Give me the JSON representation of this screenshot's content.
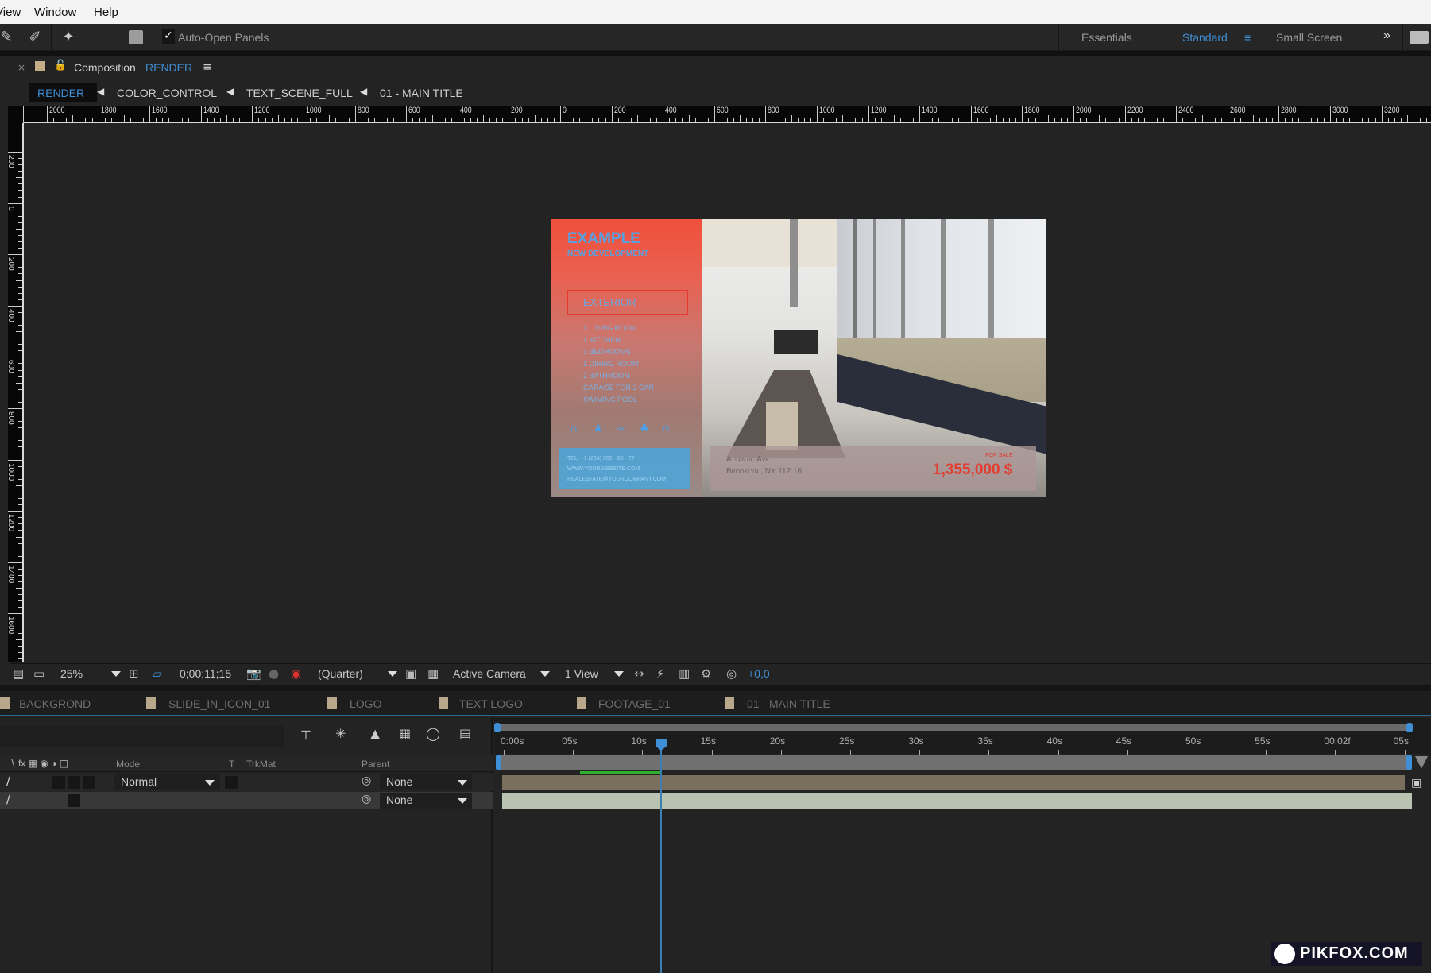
{
  "menu": {
    "items": [
      "View",
      "Window",
      "Help"
    ]
  },
  "toolbar": {
    "auto_open_panels_label": "Auto-Open Panels",
    "auto_open_checked": true,
    "workspaces": [
      "Essentials",
      "Standard",
      "Small Screen"
    ],
    "active_workspace": "Standard",
    "overflow_glyph": "»"
  },
  "composition": {
    "panel_prefix": "Composition",
    "name": "RENDER",
    "breadcrumbs": [
      "RENDER",
      "COLOR_CONTROL",
      "TEXT_SCENE_FULL",
      "01 - MAIN TITLE"
    ],
    "ruler_h_labels": [
      "2000",
      "1800",
      "1600",
      "1400",
      "1200",
      "1000",
      "800",
      "600",
      "400",
      "200",
      "0",
      "200",
      "400",
      "600",
      "800",
      "1000",
      "1200",
      "1400",
      "1600",
      "1800",
      "2000",
      "2200",
      "2400",
      "2600",
      "2800",
      "3000",
      "3200"
    ],
    "ruler_v_labels": [
      "200",
      "0",
      "200",
      "400",
      "600",
      "800",
      "1000",
      "1200",
      "1400",
      "1600"
    ]
  },
  "preview": {
    "title": "EXAMPLE",
    "subtitle": "NEW DEVELOPMENT",
    "section": "EXTERIOR",
    "features": [
      "1 LIVING ROOM",
      "1 KITCHEN",
      "3 BEDROOMS",
      "1 DINING ROOM",
      "2 BATHROOM",
      "GARAGE FOR 2 CAR",
      "SWIMING POOL"
    ],
    "contact": [
      "TEL. +1 (234) 555 - 66 - 77",
      "WWW.YOURWEBSITE.COM",
      "REALESTATE@YOURCOMPANY.COM"
    ],
    "address_line1": "Atlantic Ave",
    "address_line2": "Brooklyn , NY 112.16",
    "sale_label": "FOR SALE",
    "price": "1,355,000 $"
  },
  "viewer_bar": {
    "zoom": "25%",
    "timecode": "0;00;11;15",
    "resolution": "(Quarter)",
    "camera": "Active Camera",
    "views": "1 View",
    "exposure": "+0,0"
  },
  "timeline_tabs": [
    "BACKGROND",
    "SLIDE_IN_ICON_01",
    "LOGO",
    "TEXT LOGO",
    "FOOTAGE_01",
    "01 - MAIN TITLE"
  ],
  "timeline": {
    "columns": {
      "mode": "Mode",
      "t": "T",
      "trkmat": "TrkMat",
      "parent": "Parent"
    },
    "layers": [
      {
        "mode": "Normal",
        "parent": "None"
      },
      {
        "mode": "",
        "parent": "None"
      }
    ],
    "time_labels": [
      "0:00s",
      "05s",
      "10s",
      "15s",
      "20s",
      "25s",
      "30s",
      "35s",
      "40s",
      "45s",
      "50s",
      "55s",
      "00:02f",
      "05s"
    ],
    "playhead_seconds": 11.5
  },
  "watermark": "PIKFOX.COM",
  "colors": {
    "accent_blue": "#3f8fd6",
    "price_red": "#e53a2e",
    "label_swatch": "#b8a78a"
  }
}
